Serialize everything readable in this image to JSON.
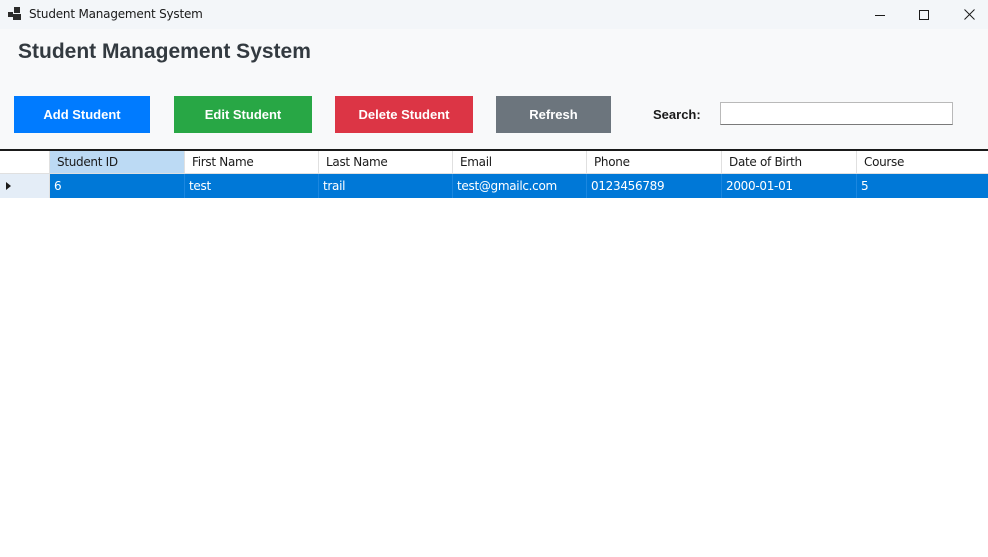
{
  "window": {
    "title": "Student Management System",
    "minimize_icon": "minimize-icon",
    "maximize_icon": "maximize-icon",
    "close_icon": "close-icon"
  },
  "heading": "Student Management System",
  "toolbar": {
    "add_label": "Add Student",
    "edit_label": "Edit Student",
    "delete_label": "Delete Student",
    "refresh_label": "Refresh",
    "search_label": "Search:",
    "search_value": ""
  },
  "colors": {
    "add": "#007bff",
    "edit": "#28a745",
    "delete": "#dc3545",
    "refresh": "#6c757d",
    "selection": "#0078d7"
  },
  "grid": {
    "columns": [
      "Student ID",
      "First Name",
      "Last Name",
      "Email",
      "Phone",
      "Date of Birth",
      "Course"
    ],
    "rows": [
      [
        "6",
        "test",
        "trail",
        "test@gmailc.com",
        "0123456789",
        "2000-01-01",
        "5"
      ]
    ]
  }
}
